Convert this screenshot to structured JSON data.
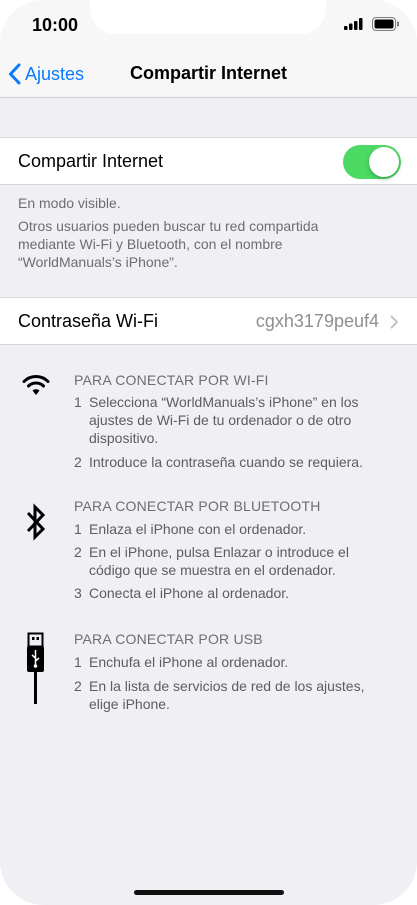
{
  "status_bar": {
    "time": "10:00"
  },
  "nav": {
    "back_label": "Ajustes",
    "title": "Compartir Internet"
  },
  "hotspot": {
    "label": "Compartir Internet",
    "enabled": true,
    "toggle_color": "#4cd964"
  },
  "visibility": {
    "status": "En modo visible.",
    "description": [
      "Otros usuarios pueden buscar tu red compartida",
      "mediante Wi-Fi y Bluetooth, con el nombre",
      "“WorldManuals’s iPhone”."
    ]
  },
  "wifi_password": {
    "label": "Contraseña Wi-Fi",
    "value": "cgxh3179peuf4"
  },
  "sections": {
    "wifi": {
      "icon": "wifi-icon",
      "title": "PARA CONECTAR POR WI-FI",
      "steps": [
        {
          "num": "1",
          "lines": [
            "Selecciona “WorldManuals’s iPhone” en los",
            "ajustes de Wi-Fi de tu ordenador o de otro",
            "dispositivo."
          ]
        },
        {
          "num": "2",
          "lines": [
            "Introduce la contraseña cuando se requiera."
          ]
        }
      ]
    },
    "bluetooth": {
      "icon": "bluetooth-icon",
      "title": "PARA CONECTAR POR BLUETOOTH",
      "steps": [
        {
          "num": "1",
          "lines": [
            "Enlaza el iPhone con el ordenador."
          ]
        },
        {
          "num": "2",
          "lines": [
            "En el iPhone, pulsa Enlazar o introduce el",
            "código que se muestra en el ordenador."
          ]
        },
        {
          "num": "3",
          "lines": [
            "Conecta el iPhone al ordenador."
          ]
        }
      ]
    },
    "usb": {
      "icon": "usb-cable-icon",
      "title": "PARA CONECTAR POR USB",
      "steps": [
        {
          "num": "1",
          "lines": [
            "Enchufa el iPhone al ordenador."
          ]
        },
        {
          "num": "2",
          "lines": [
            "En la lista de servicios de red de los ajustes,",
            "elige iPhone."
          ]
        }
      ]
    }
  },
  "colors": {
    "accent": "#0a7aff",
    "background": "#efeff4",
    "secondary_text": "#6d6d72"
  }
}
